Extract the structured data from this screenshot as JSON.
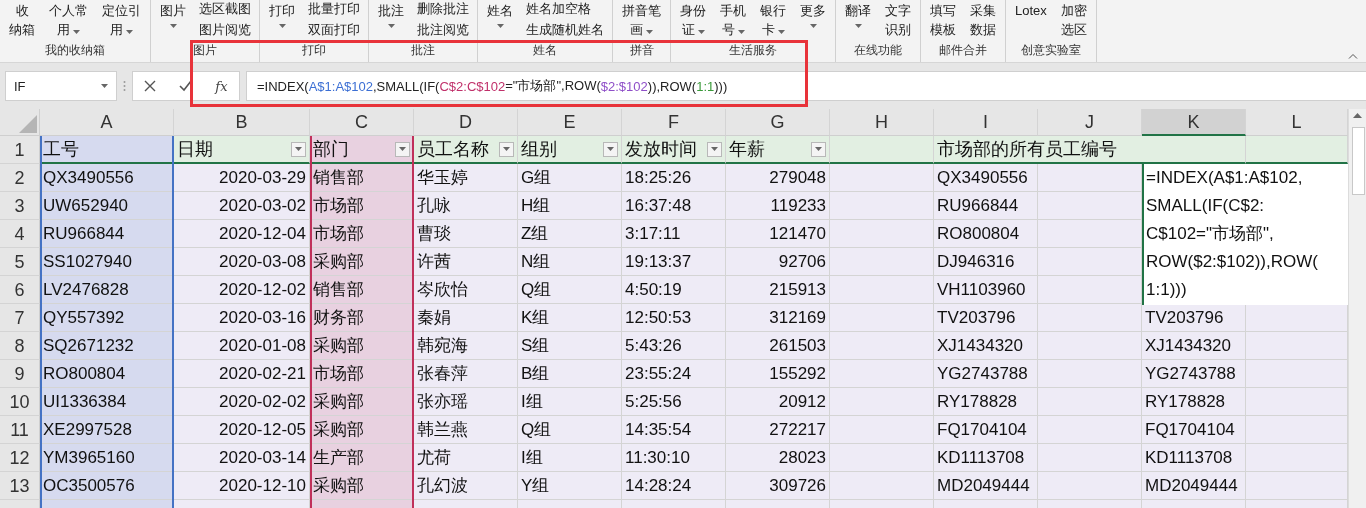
{
  "ribbon": {
    "groups": [
      {
        "label": "我的收纳箱",
        "items": [
          {
            "kind": "big",
            "label_lines": [
              "收",
              "纳箱"
            ]
          },
          {
            "kind": "big",
            "label_lines": [
              "个人常",
              "用"
            ],
            "menu": true
          },
          {
            "kind": "big",
            "label_lines": [
              "定位引",
              "用"
            ],
            "menu": true
          }
        ]
      },
      {
        "label": "图片",
        "items": [
          {
            "kind": "big",
            "label_lines": [
              "图片"
            ],
            "menu": true
          },
          {
            "kind": "stack",
            "labels": [
              "选区截图",
              "图片阅览"
            ]
          }
        ]
      },
      {
        "label": "打印",
        "items": [
          {
            "kind": "big",
            "label_lines": [
              "打印"
            ],
            "menu": true
          },
          {
            "kind": "stack",
            "labels": [
              "批量打印",
              "双面打印"
            ]
          }
        ]
      },
      {
        "label": "批注",
        "items": [
          {
            "kind": "big",
            "label_lines": [
              "批注"
            ],
            "menu": true
          },
          {
            "kind": "stack",
            "labels": [
              "删除批注",
              "批注阅览"
            ]
          }
        ]
      },
      {
        "label": "姓名",
        "items": [
          {
            "kind": "big",
            "label_lines": [
              "姓名"
            ],
            "menu": true
          },
          {
            "kind": "stack",
            "labels": [
              "姓名加空格",
              "生成随机姓名"
            ]
          }
        ]
      },
      {
        "label": "拼音",
        "items": [
          {
            "kind": "big",
            "label_lines": [
              "拼音笔",
              "画"
            ],
            "menu": true
          }
        ]
      },
      {
        "label": "生活服务",
        "items": [
          {
            "kind": "big",
            "label_lines": [
              "身份",
              "证"
            ],
            "menu": true
          },
          {
            "kind": "big",
            "label_lines": [
              "手机",
              "号"
            ],
            "menu": true
          },
          {
            "kind": "big",
            "label_lines": [
              "银行",
              "卡"
            ],
            "menu": true
          },
          {
            "kind": "big",
            "label_lines": [
              "更多"
            ],
            "menu": true
          }
        ]
      },
      {
        "label": "在线功能",
        "items": [
          {
            "kind": "big",
            "label_lines": [
              "翻译"
            ],
            "menu": true
          },
          {
            "kind": "big",
            "label_lines": [
              "文字",
              "识别"
            ]
          }
        ]
      },
      {
        "label": "邮件合并",
        "items": [
          {
            "kind": "big",
            "label_lines": [
              "填写",
              "模板"
            ]
          },
          {
            "kind": "big",
            "label_lines": [
              "采集",
              "数据"
            ]
          }
        ]
      },
      {
        "label": "创意实验室",
        "items": [
          {
            "kind": "big",
            "label_lines": [
              "Lotex"
            ]
          },
          {
            "kind": "big",
            "label_lines": [
              "加密",
              "选区"
            ]
          }
        ]
      }
    ]
  },
  "formula_bar": {
    "name_box": "IF",
    "function_button": "fx",
    "formula": [
      {
        "text": "=INDEX(",
        "color": "#222222"
      },
      {
        "text": "A$1:A$102",
        "color": "#3c6fd4"
      },
      {
        "text": ",SMALL(IF(",
        "color": "#222222"
      },
      {
        "text": "C$2:C$102",
        "color": "#c0306a"
      },
      {
        "text": "=\"市场部\",ROW(",
        "color": "#222222"
      },
      {
        "text": "$2:$102",
        "color": "#8f4fc8"
      },
      {
        "text": ")),ROW(",
        "color": "#222222"
      },
      {
        "text": "1:1",
        "color": "#3a9a3a"
      },
      {
        "text": ")))",
        "color": "#222222"
      }
    ]
  },
  "sheet": {
    "columns": [
      {
        "letter": "A",
        "selected": false,
        "color": "#4472c4"
      },
      {
        "letter": "B",
        "selected": false
      },
      {
        "letter": "C",
        "selected": false,
        "color": "#c0305a"
      },
      {
        "letter": "D",
        "selected": false
      },
      {
        "letter": "E",
        "selected": false
      },
      {
        "letter": "F",
        "selected": false
      },
      {
        "letter": "G",
        "selected": false
      },
      {
        "letter": "H",
        "selected": false
      },
      {
        "letter": "I",
        "selected": false
      },
      {
        "letter": "J",
        "selected": false
      },
      {
        "letter": "K",
        "selected": true
      },
      {
        "letter": "L",
        "selected": false
      }
    ],
    "header_row": {
      "number": "1",
      "cells": [
        {
          "text": "工号",
          "filter": false
        },
        {
          "text": "日期",
          "filter": true
        },
        {
          "text": "部门",
          "filter": true
        },
        {
          "text": "员工名称",
          "filter": true
        },
        {
          "text": "组别",
          "filter": true
        },
        {
          "text": "发放时间",
          "filter": true
        },
        {
          "text": "年薪",
          "filter": true
        }
      ],
      "result_title": "市场部的所有员工编号"
    },
    "rows": [
      {
        "number": "2",
        "id": "QX3490556",
        "date": "2020-03-29",
        "dept": "销售部",
        "name": "华玉婷",
        "group": "G组",
        "time": "18:25:26",
        "salary": "279048",
        "result": "QX3490556"
      },
      {
        "number": "3",
        "id": "UW652940",
        "date": "2020-03-02",
        "dept": "市场部",
        "name": "孔咏",
        "group": "H组",
        "time": "16:37:48",
        "salary": "119233",
        "result": "RU966844"
      },
      {
        "number": "4",
        "id": "RU966844",
        "date": "2020-12-04",
        "dept": "市场部",
        "name": "曹琰",
        "group": "Z组",
        "time": "3:17:11",
        "salary": "121470",
        "result": "RO800804"
      },
      {
        "number": "5",
        "id": "SS1027940",
        "date": "2020-03-08",
        "dept": "采购部",
        "name": "许茜",
        "group": "N组",
        "time": "19:13:37",
        "salary": "92706",
        "result": "DJ946316"
      },
      {
        "number": "6",
        "id": "LV2476828",
        "date": "2020-12-02",
        "dept": "销售部",
        "name": "岑欣怡",
        "group": "Q组",
        "time": "4:50:19",
        "salary": "215913",
        "result": "VH1103960"
      },
      {
        "number": "7",
        "id": "QY557392",
        "date": "2020-03-16",
        "dept": "财务部",
        "name": "秦娟",
        "group": "K组",
        "time": "12:50:53",
        "salary": "312169",
        "result": "TV203796",
        "copy": "TV203796"
      },
      {
        "number": "8",
        "id": "SQ2671232",
        "date": "2020-01-08",
        "dept": "采购部",
        "name": "韩宛海",
        "group": "S组",
        "time": "5:43:26",
        "salary": "261503",
        "result": "XJ1434320",
        "copy": "XJ1434320"
      },
      {
        "number": "9",
        "id": "RO800804",
        "date": "2020-02-21",
        "dept": "市场部",
        "name": "张春萍",
        "group": "B组",
        "time": "23:55:24",
        "salary": "155292",
        "result": "YG2743788",
        "copy": "YG2743788"
      },
      {
        "number": "10",
        "id": "UI1336384",
        "date": "2020-02-02",
        "dept": "采购部",
        "name": "张亦瑶",
        "group": "I组",
        "time": "5:25:56",
        "salary": "20912",
        "result": "RY178828",
        "copy": "RY178828"
      },
      {
        "number": "11",
        "id": "XE2997528",
        "date": "2020-12-05",
        "dept": "采购部",
        "name": "韩兰燕",
        "group": "Q组",
        "time": "14:35:54",
        "salary": "272217",
        "result": "FQ1704104",
        "copy": "FQ1704104"
      },
      {
        "number": "12",
        "id": "YM3965160",
        "date": "2020-03-14",
        "dept": "生产部",
        "name": "尤荷",
        "group": "I组",
        "time": "11:30:10",
        "salary": "28023",
        "result": "KD1113708",
        "copy": "KD1113708"
      },
      {
        "number": "13",
        "id": "OC3500576",
        "date": "2020-12-10",
        "dept": "采购部",
        "name": "孔幻波",
        "group": "Y组",
        "time": "14:28:24",
        "salary": "309726",
        "result": "MD2049444",
        "copy": "MD2049444"
      }
    ],
    "editor_lines": [
      "=INDEX(A$1:A$102,",
      "SMALL(IF(C$2:",
      "C$102=\"市场部\",",
      "ROW($2:$102)),ROW(",
      "1:1)))"
    ]
  }
}
